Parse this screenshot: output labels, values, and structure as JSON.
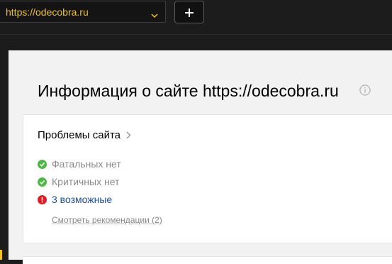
{
  "topbar": {
    "site_select_value": "https://odecobra.ru",
    "add_button_label": "+"
  },
  "main": {
    "page_title": "Информация о сайте https://odecobra.ru",
    "problems_card": {
      "title": "Проблемы сайта",
      "items": [
        {
          "label": "Фатальных нет",
          "status": "ok",
          "status_color": "#4cb944"
        },
        {
          "label": "Критичных нет",
          "status": "ok",
          "status_color": "#4cb944"
        },
        {
          "label": "3 возможные",
          "status": "warning",
          "status_color": "#e31b23"
        }
      ],
      "recommendations_link": "Смотреть рекомендации (2)"
    }
  },
  "colors": {
    "accent": "#f4c316",
    "dark_bg": "#1c1c1c",
    "content_bg": "#f2f2f2",
    "link_blue": "#1a4fa0"
  }
}
